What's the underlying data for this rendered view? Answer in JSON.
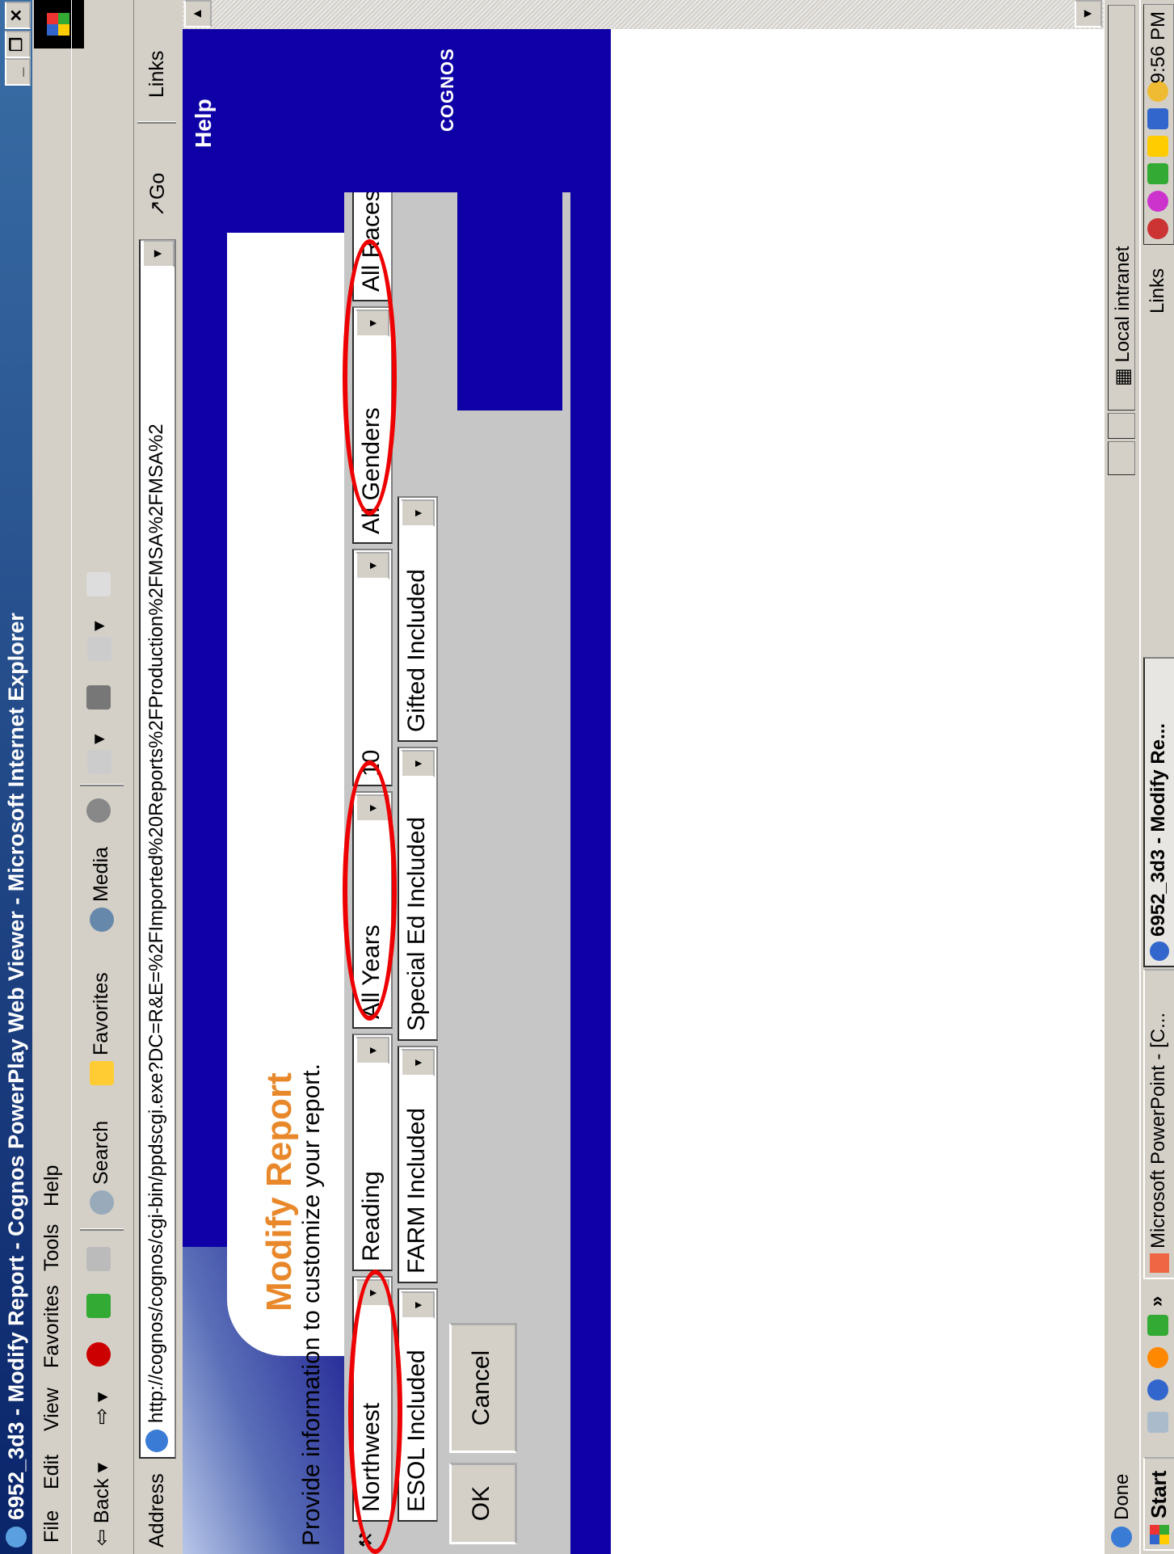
{
  "window": {
    "title": "6952_3d3 - Modify Report - Cognos PowerPlay Web Viewer - Microsoft Internet Explorer",
    "min_label": "_",
    "max_label": "❐",
    "close_label": "✕"
  },
  "menu": [
    "File",
    "Edit",
    "View",
    "Favorites",
    "Tools",
    "Help"
  ],
  "toolbar": {
    "back_label": "Back",
    "search_label": "Search",
    "favorites_label": "Favorites",
    "media_label": "Media"
  },
  "address": {
    "label": "Address",
    "url": "http://cognos/cognos/cgi-bin/ppdscgi.exe?DC=R&E=%2FImported%20Reports%2FProduction%2FMSA%2FMSA%2",
    "go_label": "Go",
    "links_label": "Links"
  },
  "report": {
    "help_label": "Help",
    "title": "Modify Report",
    "instruction": "Provide information to customize your report.",
    "brand": "COGNOS",
    "row1": [
      {
        "name": "region",
        "value": "Northwest"
      },
      {
        "name": "subject",
        "value": "Reading"
      },
      {
        "name": "year",
        "value": "All Years"
      },
      {
        "name": "grade",
        "value": "10"
      },
      {
        "name": "gender",
        "value": "All Genders"
      },
      {
        "name": "race",
        "value": "All Races"
      }
    ],
    "row2": [
      {
        "name": "esol",
        "value": "ESOL Included"
      },
      {
        "name": "farm",
        "value": "FARM Included"
      },
      {
        "name": "special-ed",
        "value": "Special Ed Included"
      },
      {
        "name": "gifted",
        "value": "Gifted Included"
      }
    ],
    "ok_label": "OK",
    "cancel_label": "Cancel"
  },
  "status": {
    "text": "Done",
    "zone": "Local intranet"
  },
  "taskbar": {
    "start_label": "Start",
    "links_label": "Links",
    "tasks": [
      {
        "label": "Microsoft PowerPoint - [C...",
        "active": false
      },
      {
        "label": "6952_3d3 - Modify Re...",
        "active": true
      }
    ],
    "clock": "9:56 PM"
  }
}
